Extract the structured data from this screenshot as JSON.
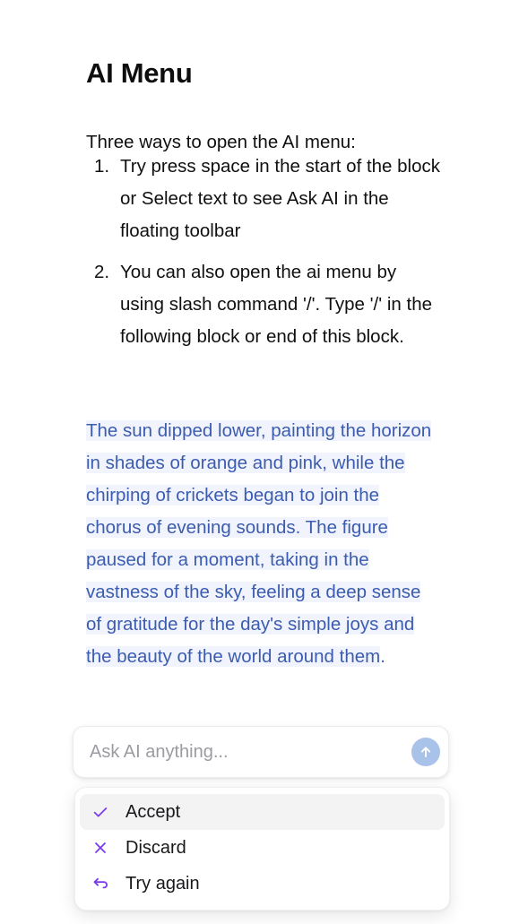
{
  "document": {
    "title": "AI Menu",
    "intro": "Three ways to open the AI menu:",
    "steps": [
      {
        "marker": "1.",
        "text": "Try press space in the start of the block or Select text to see Ask AI in the floating toolbar"
      },
      {
        "marker": "2.",
        "text": "You can also open the ai menu by using slash command '/'. Type '/' in the following block or end of this block."
      }
    ],
    "ai_paragraph": {
      "highlighted_text": "The sun dipped lower, painting the horizon in shades of orange and pink, while the chirping of crickets began to join the chorus of evening sounds. The figure paused for a moment, taking in the vastness of the sky, feeling a deep sense of gratitude for the day's simple joys and the beauty of the world around them",
      "trailing_text": ".",
      "text_color": "#3c5cb0",
      "highlight_color": "#f1f4fc"
    }
  },
  "ask_bar": {
    "placeholder": "Ask AI anything...",
    "value": "",
    "send_icon": "arrow-up-icon",
    "send_button_color": "#a9c2ea"
  },
  "ai_menu": {
    "items": [
      {
        "label": "Accept",
        "icon": "check-icon",
        "icon_color": "#7c3aed",
        "active": true
      },
      {
        "label": "Discard",
        "icon": "close-x-icon",
        "icon_color": "#7c3aed",
        "active": false
      },
      {
        "label": "Try again",
        "icon": "undo-arrow-icon",
        "icon_color": "#7c3aed",
        "active": false
      }
    ],
    "active_row_color": "#f3f3f4"
  }
}
